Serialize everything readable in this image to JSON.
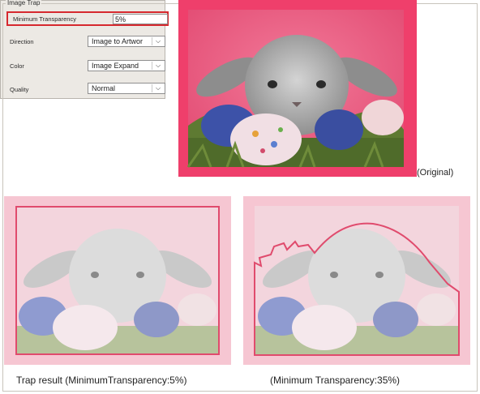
{
  "panel": {
    "legend": "Image Trap",
    "rows": [
      {
        "label": "Minimum Transparency",
        "value": "5%"
      },
      {
        "label": "Direction",
        "value": "Image to Artwor"
      },
      {
        "label": "Color",
        "value": "Image Expand"
      },
      {
        "label": "Quality",
        "value": "Normal"
      }
    ]
  },
  "captions": {
    "original": "(Original)",
    "trap5": "Trap result (MinimumTransparency:5%)",
    "trap35": "(Minimum Transparency:35%)"
  },
  "colors": {
    "original_frame": "#ef3f6b",
    "trap_outline": "#e04b6d",
    "faded_frame": "#f6c6d2",
    "highlight_red": "#d6292f"
  }
}
